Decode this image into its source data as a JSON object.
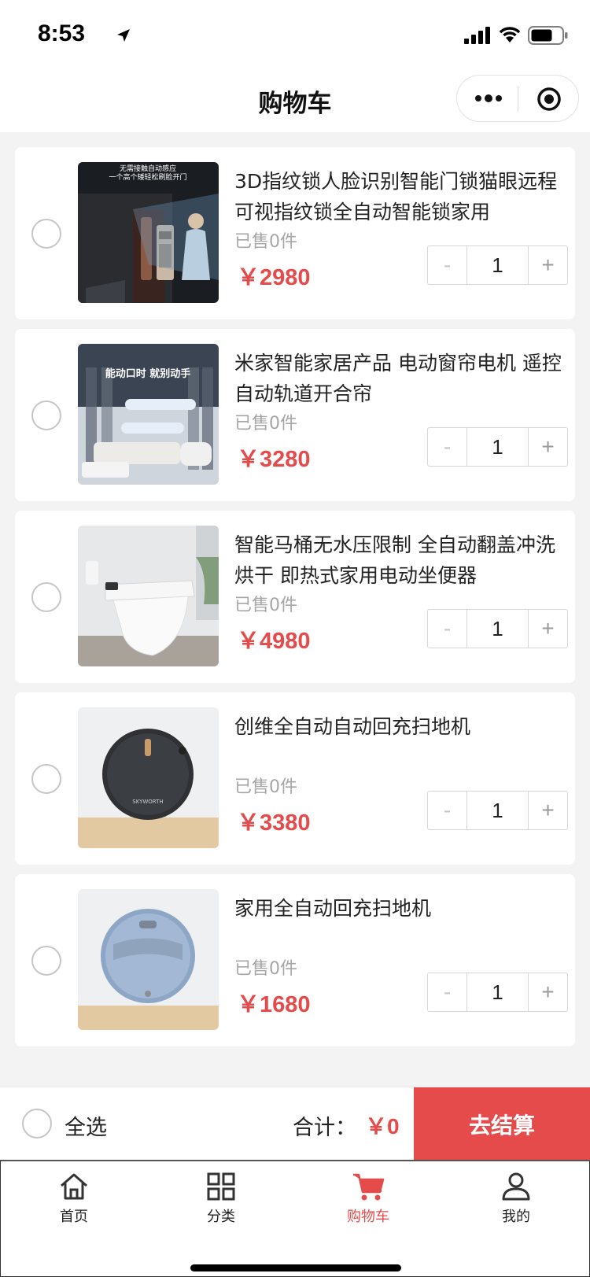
{
  "status": {
    "time": "8:53"
  },
  "nav": {
    "title": "购物车"
  },
  "items": [
    {
      "title": "3D指纹锁人脸识别智能门锁猫眼远程可视指纹锁全自动智能锁家用",
      "sold": "已售0件",
      "price": "￥2980",
      "qty": "1",
      "image_text": [
        "无需接触自动感应",
        "一个高个矮轻松刷脸开门"
      ]
    },
    {
      "title": "米家智能家居产品 电动窗帘电机 遥控自动轨道开合帘",
      "sold": "已售0件",
      "price": "￥3280",
      "qty": "1",
      "image_text": [
        "能动口时 就别动手"
      ]
    },
    {
      "title": "智能马桶无水压限制 全自动翻盖冲洗烘干 即热式家用电动坐便器",
      "sold": "已售0件",
      "price": "￥4980",
      "qty": "1"
    },
    {
      "title": "创维全自动自动回充扫地机",
      "sold": "已售0件",
      "price": "￥3380",
      "qty": "1",
      "image_text": [
        "SKYWORTH"
      ]
    },
    {
      "title": "家用全自动回充扫地机",
      "sold": "已售0件",
      "price": "￥1680",
      "qty": "1"
    }
  ],
  "stepper": {
    "minus": "-",
    "plus": "+"
  },
  "checkout": {
    "select_all": "全选",
    "total_label": "合计：",
    "total_value": "￥0",
    "button": "去结算"
  },
  "tabs": [
    {
      "label": "首页",
      "icon": "home-icon"
    },
    {
      "label": "分类",
      "icon": "grid-icon"
    },
    {
      "label": "购物车",
      "icon": "cart-icon",
      "active": true
    },
    {
      "label": "我的",
      "icon": "user-icon"
    }
  ],
  "colors": {
    "accent": "#e54b4b",
    "background": "#f3f3f3"
  }
}
